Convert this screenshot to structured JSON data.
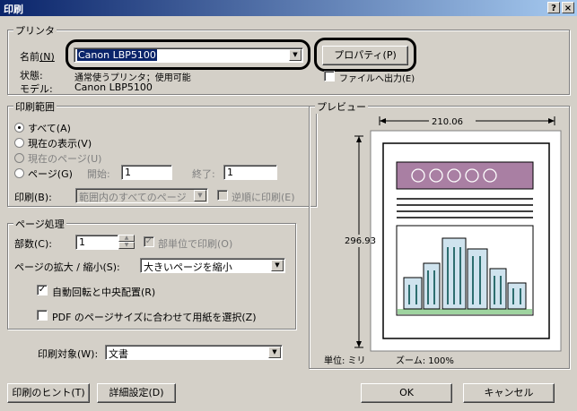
{
  "window": {
    "title": "印刷",
    "help": "?",
    "close": "×"
  },
  "printer": {
    "group_title": "プリンタ",
    "name_label": "名前",
    "name_key": "(N)",
    "name_value": "Canon LBP5100",
    "properties_label": "プロパティ(P)",
    "status_label": "状態:",
    "status_value": "通常使うプリンタ；使用可能",
    "model_label": "モデル:",
    "model_value": "Canon LBP5100",
    "print_to_file_label": "ファイルへ出力(E)"
  },
  "range": {
    "group_title": "印刷範囲",
    "all": "すべて(A)",
    "current_view": "現在の表示(V)",
    "current_page": "現在のページ(U)",
    "pages": "ページ(G)",
    "start_label": "開始:",
    "start_value": "1",
    "end_label": "終了:",
    "end_value": "1",
    "print_label": "印刷(B):",
    "print_value": "範囲内のすべてのページ",
    "reverse_label": "逆順に印刷(E)"
  },
  "handling": {
    "group_title": "ページ処理",
    "copies_label": "部数(C):",
    "copies_value": "1",
    "collate_label": "部単位で印刷(O)",
    "scaling_label": "ページの拡大 / 縮小(S):",
    "scaling_value": "大きいページを縮小",
    "autorotate_label": "自動回転と中央配置(R)",
    "pdf_size_label": "PDF のページサイズに合わせて用紙を選択(Z)"
  },
  "print_what": {
    "label": "印刷対象(W):",
    "value": "文書"
  },
  "preview": {
    "group_title": "プレビュー",
    "width_value": "210.06",
    "height_value": "296.93",
    "unit_label": "単位: ミリ",
    "zoom_label": "ズーム: 100%"
  },
  "footer": {
    "hints": "印刷のヒント(T)",
    "advanced": "詳細設定(D)",
    "ok": "OK",
    "cancel": "キャンセル"
  }
}
